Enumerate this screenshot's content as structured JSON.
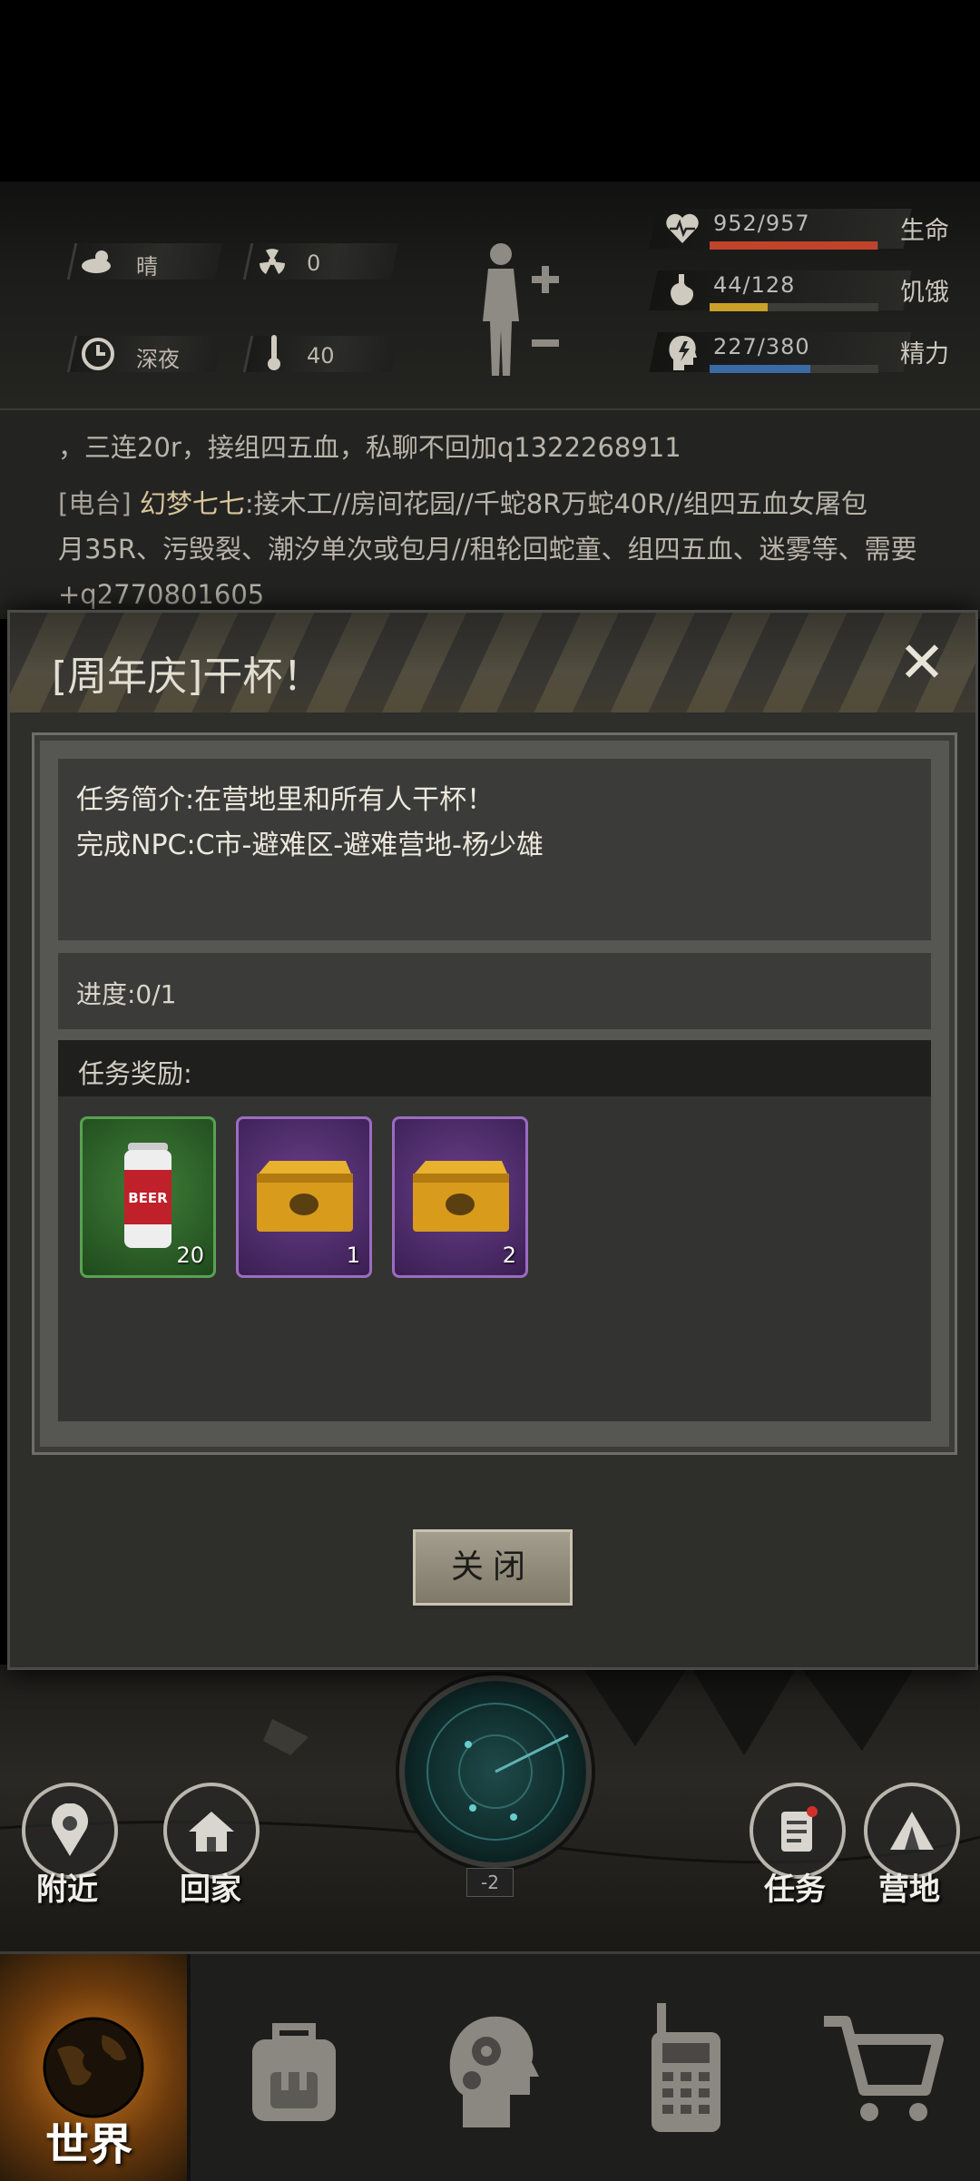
{
  "status": {
    "weather": {
      "label": "晴",
      "icon": "cloud-sun-icon"
    },
    "radiation": {
      "value": "0",
      "icon": "radiation-icon"
    },
    "time": {
      "label": "深夜",
      "icon": "clock-icon"
    },
    "temperature": {
      "value": "40",
      "icon": "thermometer-icon"
    },
    "vitals": [
      {
        "name": "生命",
        "value": "952/957",
        "fraction": 0.995,
        "color": "#c0442a",
        "icon": "heart-icon"
      },
      {
        "name": "饥饿",
        "value": "44/128",
        "fraction": 0.344,
        "color": "#c9a227",
        "icon": "stomach-icon"
      },
      {
        "name": "精力",
        "value": "227/380",
        "fraction": 0.597,
        "color": "#3b6aa6",
        "icon": "energy-head-icon"
      }
    ]
  },
  "chat": {
    "line1": "，三连20r，接组四五血，私聊不回加q1322268911",
    "line2_channel": "[电台]",
    "line2_sender": "幻梦七七",
    "line2_text": ":接木工//房间花园//千蛇8R万蛇40R//组四五血女屠包",
    "line3": "月35R、污毁裂、潮汐单次或包月//租轮回蛇童、组四五血、迷雾等、需要",
    "line4": "+q2770801605"
  },
  "dialog": {
    "title": "[周年庆]干杯！",
    "description": "任务简介:在营地里和所有人干杯！",
    "npc": "完成NPC:C市-避难区-避难营地-杨少雄",
    "progress": "进度:0/1",
    "rewards_title": "任务奖励:",
    "rewards": [
      {
        "name": "beer-can",
        "count": "20",
        "rarity": "green"
      },
      {
        "name": "supply-crate",
        "count": "1",
        "rarity": "purple"
      },
      {
        "name": "supply-crate",
        "count": "2",
        "rarity": "purple"
      }
    ],
    "close_button": "关闭"
  },
  "scene": {
    "radar_level": "-2",
    "nearby": "附近",
    "home": "回家",
    "quest": "任务",
    "camp": "营地"
  },
  "tabs": {
    "world": "世界"
  }
}
